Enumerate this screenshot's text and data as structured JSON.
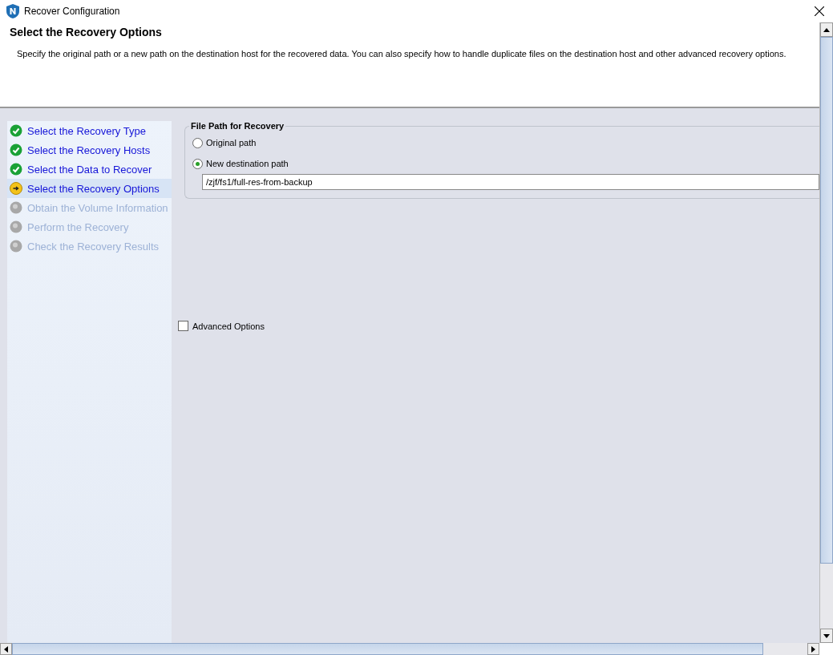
{
  "window": {
    "title": "Recover Configuration"
  },
  "header": {
    "title": "Select the Recovery Options",
    "description": "Specify the original path or a new path on the destination host for the recovered data. You can also specify how to handle duplicate files on the destination host and other advanced recovery options."
  },
  "steps": [
    {
      "label": "Select the Recovery Type",
      "kind": "done",
      "selected": false
    },
    {
      "label": "Select the Recovery Hosts",
      "kind": "done",
      "selected": false
    },
    {
      "label": "Select the Data to Recover",
      "kind": "done",
      "selected": false
    },
    {
      "label": "Select the Recovery Options",
      "kind": "current",
      "selected": true
    },
    {
      "label": "Obtain the Volume Information",
      "kind": "pending",
      "selected": false
    },
    {
      "label": "Perform the Recovery",
      "kind": "pending",
      "selected": false
    },
    {
      "label": "Check the Recovery Results",
      "kind": "pending",
      "selected": false
    }
  ],
  "file_path": {
    "title": "File Path for Recovery",
    "options": [
      {
        "label": "Original path",
        "selected": false
      },
      {
        "label": "New destination path",
        "selected": true
      }
    ],
    "path_value": "/zjf/fs1/full-res-from-backup"
  },
  "advanced_options": {
    "label": "Advanced Options",
    "checked": false
  }
}
